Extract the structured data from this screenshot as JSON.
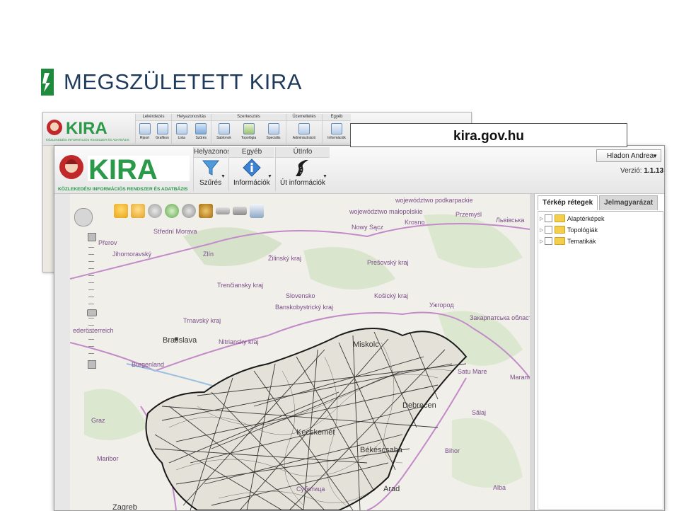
{
  "slide": {
    "title": "MEGSZÜLETETT KIRA",
    "url_label": "kira.gov.hu"
  },
  "colors": {
    "title": "#1f3a5a",
    "logo_green": "#1e8a3c",
    "kira_brand_green": "#2a9a4a",
    "kira_brand_red": "#c0282a",
    "map_background": "#f1efe9",
    "road_network": "#1a1a1a"
  },
  "back_window": {
    "logo_text": "KIRA",
    "logo_subtitle": "KÖZLEKEDÉSI INFORMÁCIÓS RENDSZER ÉS ADATBÁZIS",
    "groups": [
      {
        "title": "Lekérdezés",
        "items": [
          "Riport",
          "Grafikon"
        ]
      },
      {
        "title": "Helyazonosítás",
        "items": [
          "Lista",
          "Szűrés"
        ]
      },
      {
        "title": "Szerkesztés",
        "items": [
          "Sablonok",
          "Topológia",
          "Speciális"
        ]
      },
      {
        "title": "Üzemeltetés",
        "items": [
          "Adminisztráció"
        ]
      },
      {
        "title": "Egyéb",
        "items": [
          "Információk"
        ]
      }
    ]
  },
  "front_window": {
    "logo_text": "KIRA",
    "logo_subtitle": "KÖZLEKEDÉSI INFORMÁCIÓS RENDSZER ÉS ADATBÁZIS",
    "groups": [
      {
        "title": "Helyazonosí",
        "item": "Szűrés",
        "icon": "funnel-icon"
      },
      {
        "title": "Egyéb",
        "item": "Információk",
        "icon": "info-icon"
      },
      {
        "title": "ÚtInfo",
        "item": "Út információk",
        "icon": "road-icon"
      }
    ],
    "user": "Hladon Andrea",
    "version_label": "Verzió:",
    "version_value": "1.1.13",
    "tabs": [
      "Térkép rétegek",
      "Jelmagyarázat"
    ],
    "layers": [
      "Alaptérképek",
      "Topológiák",
      "Tematikák"
    ],
    "map_labels": {
      "bratislava": "Bratislava",
      "zilina": "Žilinský kraj",
      "presov": "Prešovský kraj",
      "kosice": "Košický kraj",
      "trencin": "Trenčiansky kraj",
      "slovensko": "Slovensko",
      "bbystrica": "Banskobystrický kraj",
      "trnava": "Trnavský kraj",
      "nitra": "Nitriansky kraj",
      "zlin": "Zlín",
      "jihomoravsky": "Jihomoravský",
      "stredni_morava": "Střední Morava",
      "prerov": "Přerov",
      "nowy_sacz": "Nowy Sącz",
      "krosno": "Krosno",
      "przemysl": "Przemyśl",
      "podkarpackie": "województwo podkarpackie",
      "malopolskie": "województwo małopolskie",
      "uzhgorod": "Ужгород",
      "zakarpatska": "Закарпатська область",
      "miskolc": "Miskolc",
      "debrecen": "Debrecen",
      "kecskemet": "Kecskemét",
      "bekescsaba": "Békéscsaba",
      "arad": "Arad",
      "satu_mare": "Satu Mare",
      "salaj": "Sălaj",
      "bihor": "Bihor",
      "alba": "Alba",
      "maramures": "Maram",
      "burgenland": "Burgenland",
      "graz": "Graz",
      "maribor": "Maribor",
      "zagreb": "Zagreb",
      "niederoesterreich": "ederösterreich",
      "subotica": "Суботица",
      "lviv": "Львівська"
    }
  }
}
